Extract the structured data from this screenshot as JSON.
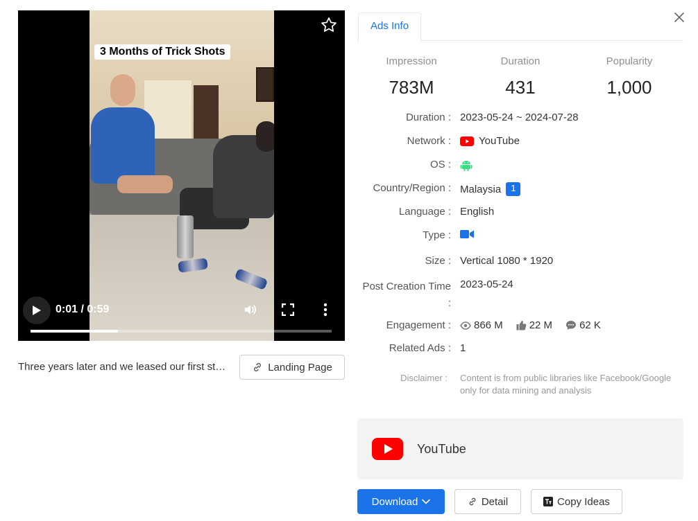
{
  "video": {
    "title": "3 Months of Trick Shots",
    "time": "0:01 / 0:59",
    "progress": 0.29,
    "caption": "Three years later and we leased our first st…",
    "landing_page_label": "Landing Page"
  },
  "tabs": [
    "Ads Info"
  ],
  "stats": [
    {
      "label": "Impression",
      "value": "783M"
    },
    {
      "label": "Duration",
      "value": "431"
    },
    {
      "label": "Popularity",
      "value": "1,000"
    }
  ],
  "info": {
    "duration_label": "Duration :",
    "duration_value": "2023-05-24 ~ 2024-07-28",
    "network_label": "Network :",
    "network_value": "YouTube",
    "os_label": "OS :",
    "os_icon": "android-icon",
    "country_label": "Country/Region :",
    "country_value": "Malaysia",
    "country_badge": "1",
    "language_label": "Language :",
    "language_value": "English",
    "type_label": "Type :",
    "type_icon": "video-camera-icon",
    "size_label": "Size :",
    "size_value": "Vertical 1080 * 1920",
    "post_label_line1": "Post Creation Time",
    "post_label_line2": ":",
    "post_value": "2023-05-24",
    "engagement_label": "Engagement :",
    "views": "866 M",
    "likes": "22 M",
    "comments": "62 K",
    "related_label": "Related Ads :",
    "related_value": "1",
    "disclaimer_label": "Disclaimer :",
    "disclaimer_text": "Content is from public libraries like Facebook/Google only for data mining and analysis"
  },
  "network_card": {
    "name": "YouTube"
  },
  "actions": {
    "download": "Download",
    "detail": "Detail",
    "copy_ideas": "Copy Ideas"
  },
  "colors": {
    "accent": "#1a73e8",
    "youtube_red": "#ff0000",
    "android_green": "#3ddc84"
  }
}
